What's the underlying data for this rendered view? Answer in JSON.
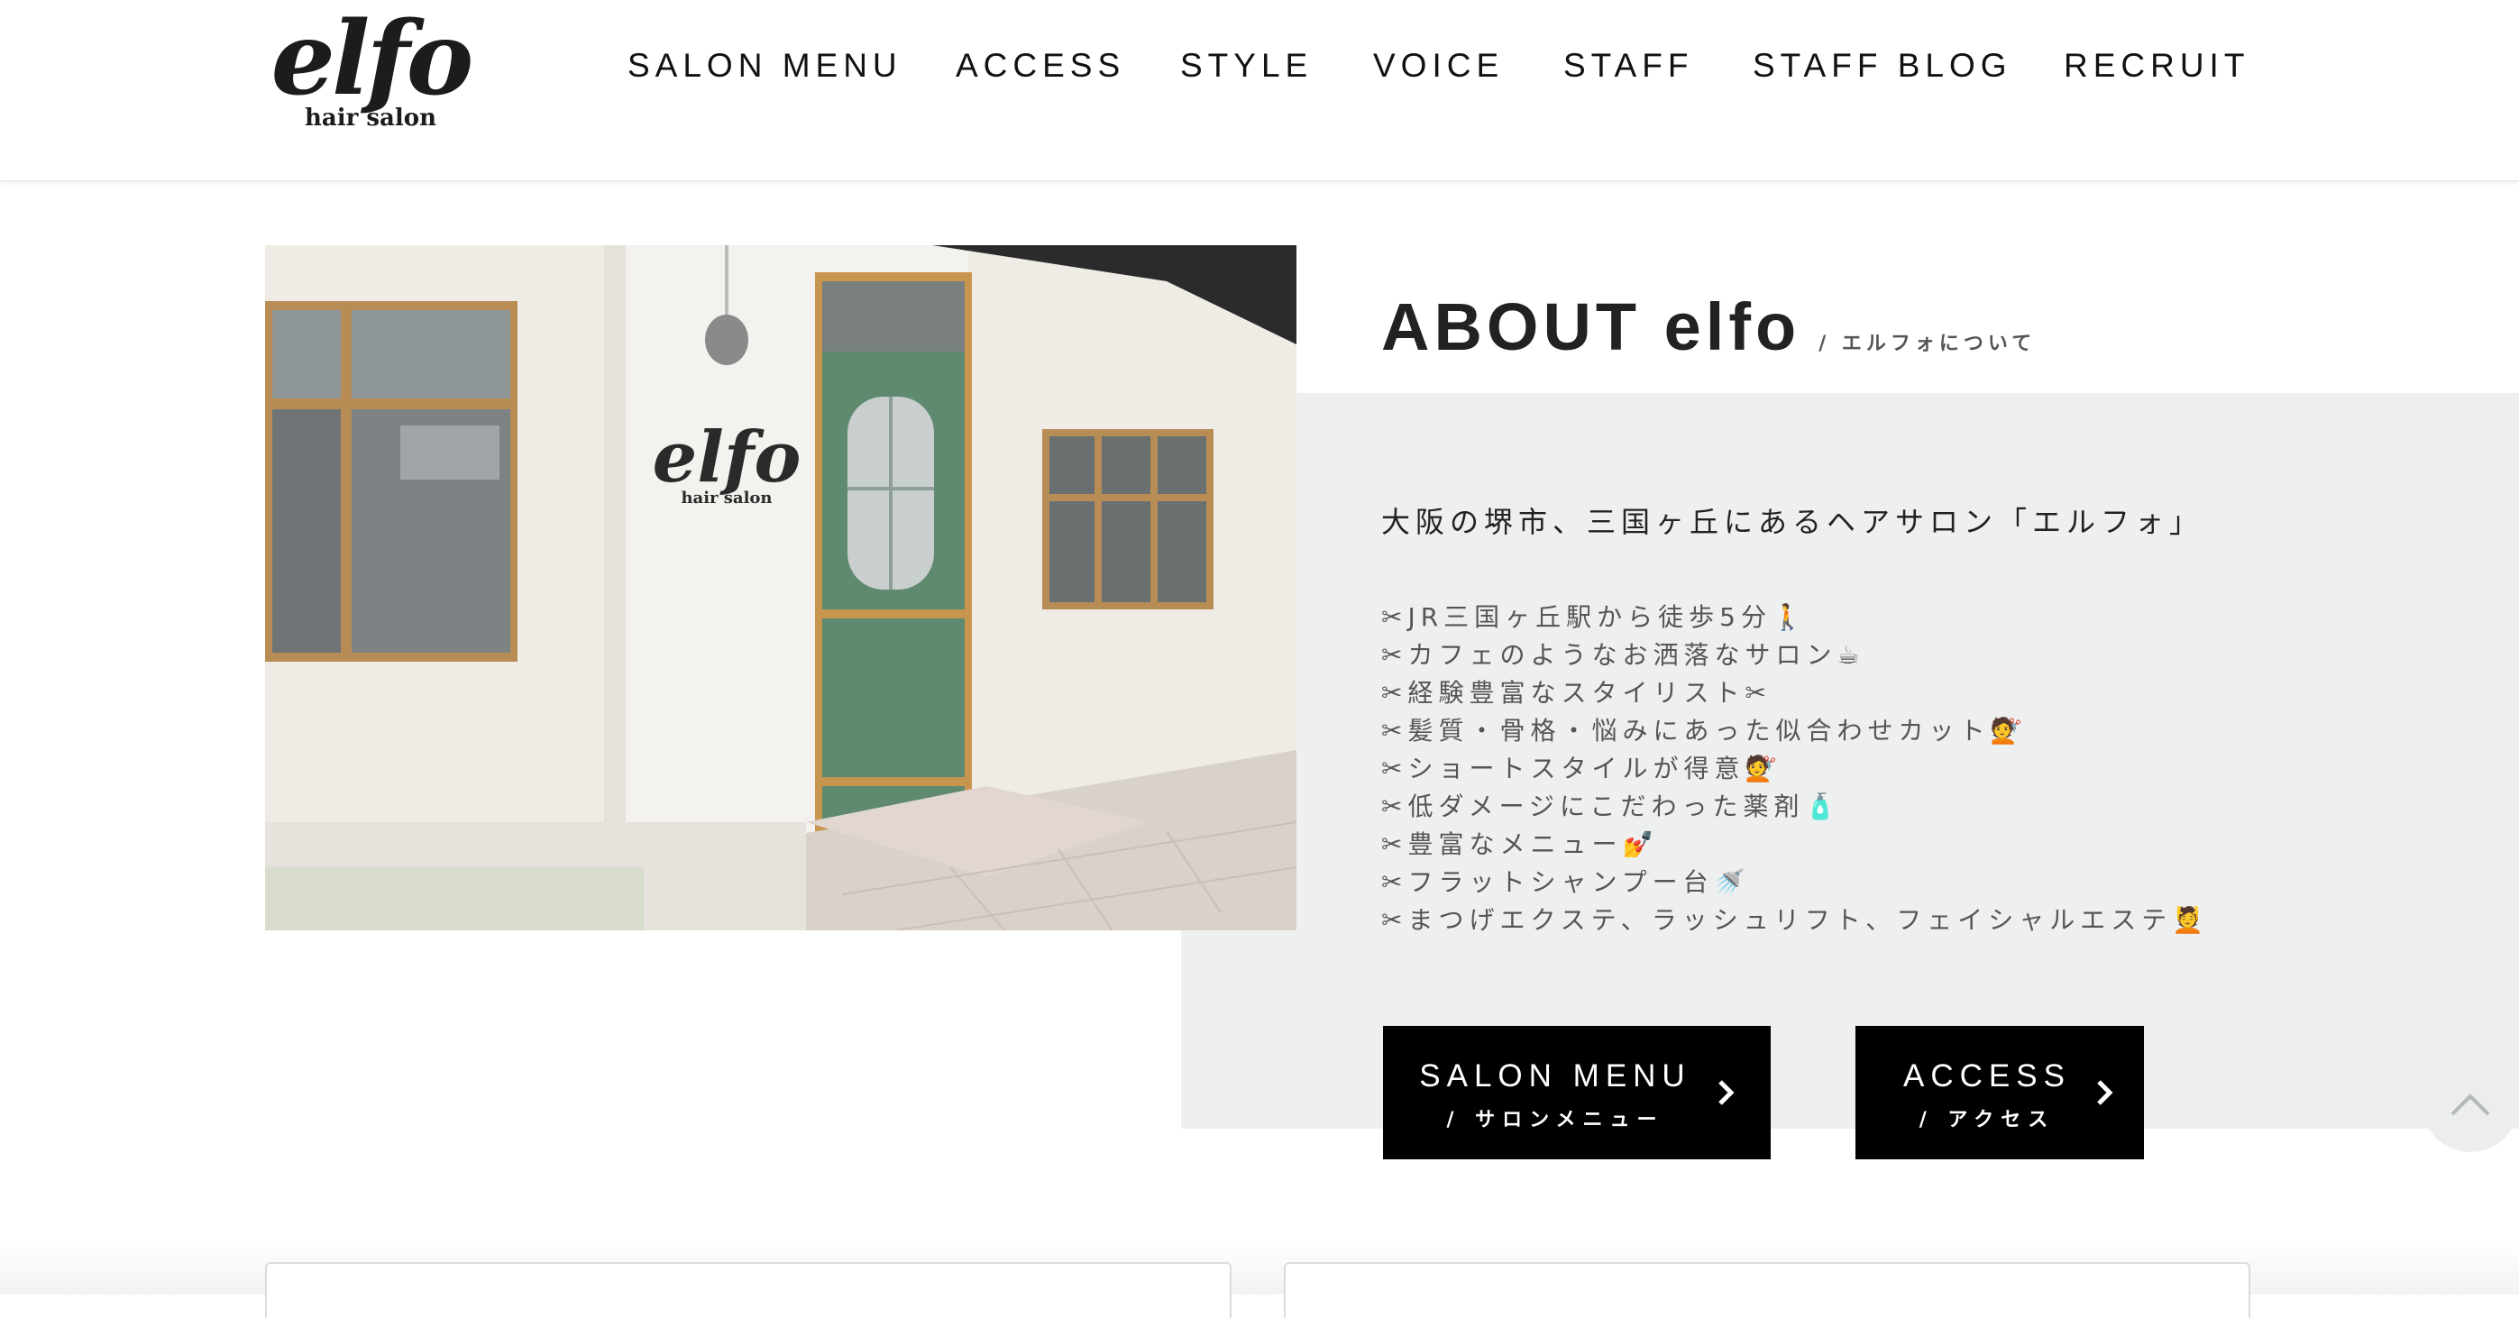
{
  "logo": {
    "wordmark": "elfo",
    "subtitle": "hair salon"
  },
  "nav": {
    "items": [
      {
        "label": "SALON MENU"
      },
      {
        "label": "ACCESS"
      },
      {
        "label": "STYLE"
      },
      {
        "label": "VOICE"
      },
      {
        "label": "STAFF"
      },
      {
        "label": "STAFF BLOG"
      },
      {
        "label": "RECRUIT"
      }
    ]
  },
  "photo": {
    "sign_word": "elfo",
    "sign_sub": "hair salon"
  },
  "about": {
    "title": "ABOUT elfo",
    "subtitle": "/ エルフォについて",
    "lead": "大阪の堺市、三国ヶ丘にあるヘアサロン「エルフォ」",
    "features": [
      "✂JR三国ヶ丘駅から徒歩5分🚶",
      "✂カフェのようなお洒落なサロン☕",
      "✂経験豊富なスタイリスト✂",
      "✂髪質・骨格・悩みにあった似合わせカット💇",
      "✂ショートスタイルが得意💇",
      "✂低ダメージにこだわった薬剤🧴",
      "✂豊富なメニュー💅",
      "✂フラットシャンプー台🚿",
      "✂まつげエクステ、ラッシュリフト、フェイシャルエステ💆"
    ]
  },
  "buttons": {
    "salon_menu": {
      "label": "SALON MENU",
      "sublabel": "/ サロンメニュー"
    },
    "access": {
      "label": "ACCESS",
      "sublabel": "/ アクセス"
    }
  },
  "icons": {
    "chevron": "chevron-right-icon",
    "scroll_top": "chevron-up-icon"
  },
  "colors": {
    "panel": "#eef0ef",
    "button": "#000000",
    "door": "#5f8a6f"
  }
}
